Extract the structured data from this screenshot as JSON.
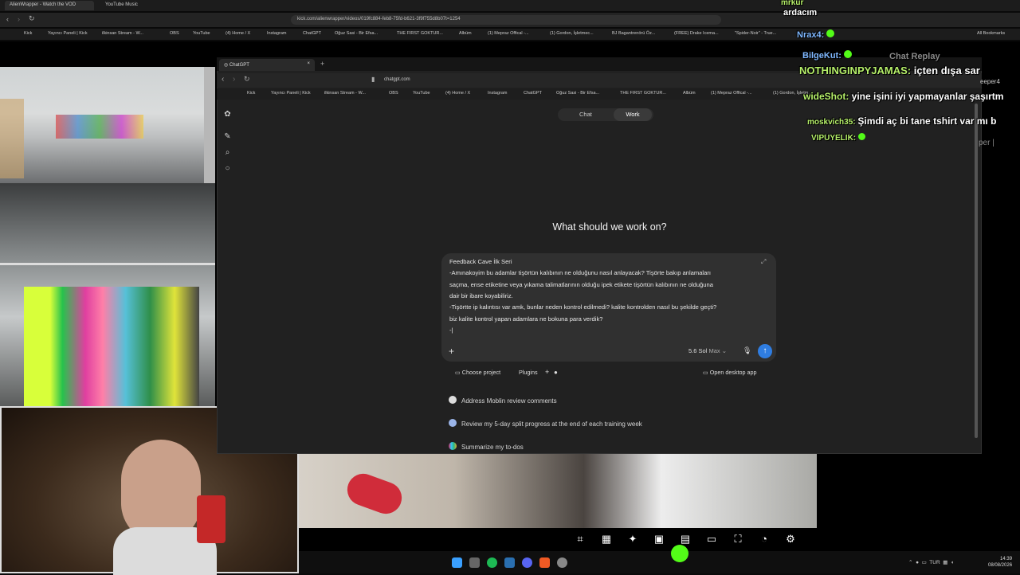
{
  "outer_browser": {
    "tabs": [
      "AlienWrapper - Watch the VOD",
      "YouTube Music"
    ],
    "url": "kick.com/alienwrapper/videos/019fc884-feb8-75fd-b621-3f9f755d8b07t=1254",
    "bookmarks": [
      "Kick",
      "Yayıncı Paneli | Kick",
      "ilkinsan Stream - W...",
      "OBS",
      "YouTube",
      "(4) Home / X",
      "Instagram",
      "ChatGPT",
      "Oğuz Sasi - Bir Efsa...",
      "THE FIRST GOKTUR...",
      "Albüm",
      "(1) Mepraz Offical -...",
      "(1) Gordon, İşletmec...",
      "BJ Bagantrenörü Öz...",
      "(FREE) Drake Icema...",
      "\"Spider-Noir\" - True...",
      "All Bookmarks"
    ]
  },
  "inner_browser": {
    "tab_title": "ChatGPT",
    "url": "chatgpt.com",
    "bookmarks": [
      "Kick",
      "Yayıncı Paneli | Kick",
      "ilkinsan Stream - W...",
      "OBS",
      "YouTube",
      "(4) Home / X",
      "Instagram",
      "ChatGPT",
      "Oğuz Sasi - Bir Efsa...",
      "THE FIRST GOKTUR...",
      "Albüm",
      "(1) Mepraz Offical -...",
      "(1) Gordon, İşletm..."
    ]
  },
  "chatgpt": {
    "modes": [
      "Chat",
      "Work"
    ],
    "active_mode": "Work",
    "heading": "What should we work on?",
    "composer_lines": [
      "Feedback Cave İlk Seri",
      "-Amınakoyim bu adamlar tişörtün kalıbının ne olduğunu nasıl anlayacak? Tişörte bakıp anlamaları",
      "saçma, ense etiketine veya yıkama talimatlarının olduğu ipek etikete tişörtün kalıbının ne olduğuna",
      "dair bir ibare koyabiliriz.",
      "-Tişörtte ip kalıntısı var amk, bunlar neden kontrol edilmedi? kalite kontrolden nasıl bu şekilde geçti?",
      "biz kalite kontrol yapan adamlara ne bokuna para verdik?",
      "-|"
    ],
    "model": "5.6 Sol",
    "model_mode": "Max",
    "choose_project": "Choose project",
    "plugins": "Plugins",
    "open_desktop": "Open desktop app",
    "suggestions": [
      {
        "text": "Address Moblin review comments",
        "icon": "github-icon"
      },
      {
        "text": "Review my 5-day split progress at the end of each training week",
        "icon": "circle-icon"
      },
      {
        "text": "Summarize my to-dos",
        "icon": "slack-icon"
      }
    ]
  },
  "chat_overlay": {
    "header": "Chat Replay",
    "messages": [
      {
        "user": "mrkur",
        "text": ""
      },
      {
        "user": "ardacım",
        "text": ""
      },
      {
        "user": "Nrax4:",
        "text": ""
      },
      {
        "user": "BilgeKut:",
        "text": ""
      },
      {
        "user": "NOTHINGINPYJAMAS:",
        "text": "içten dışa sar"
      },
      {
        "user": "wideShot:",
        "text": "yine işini iyi yapmayanlar şaşırtm"
      },
      {
        "user": "moskvich35:",
        "text": "Şimdi aç bi tane tshirt var mı b"
      },
      {
        "user": "VIPUYELIK:",
        "text": ""
      }
    ],
    "side_fragments": [
      "eeper4",
      "per |",
      "per |"
    ]
  },
  "taskbar": {
    "time": "14:39",
    "date": "08/08/2026",
    "lang": "TUR"
  },
  "colors": {
    "send": "#2f7de1",
    "username": "#b6f06a"
  }
}
